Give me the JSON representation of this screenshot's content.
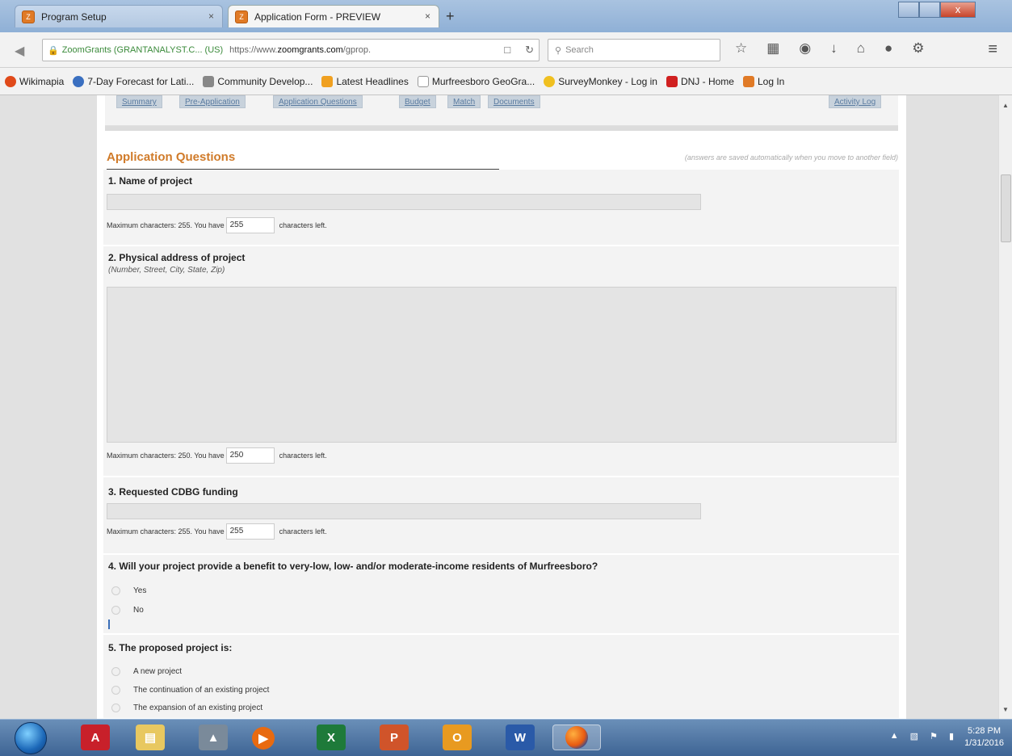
{
  "browser": {
    "tabs": [
      {
        "label": "Program Setup",
        "close": "×"
      },
      {
        "label": "Application Form - PREVIEW",
        "close": "×"
      }
    ],
    "new_tab": "+",
    "window_close": "x",
    "url_identity": "ZoomGrants (GRANTANALYST.C... (US)",
    "url_prefix": "https://www.",
    "url_domain": "zoomgrants.com",
    "url_suffix": "/gprop.",
    "search_placeholder": "Search"
  },
  "bookmarks": [
    {
      "label": "Wikimapia",
      "color": "#e04a1a"
    },
    {
      "label": "7-Day Forecast for Lati...",
      "color": "#3a6fc0"
    },
    {
      "label": "Community Develop...",
      "color": "#888888"
    },
    {
      "label": "Latest Headlines",
      "color": "#f0a020"
    },
    {
      "label": "Murfreesboro GeoGra...",
      "color": "#ffffff"
    },
    {
      "label": "SurveyMonkey - Log in",
      "color": "#f0c020"
    },
    {
      "label": "DNJ - Home",
      "color": "#d02020"
    },
    {
      "label": "Log In",
      "color": "#e07a26"
    }
  ],
  "page_tabs": [
    "Summary",
    "Pre-Application",
    "Application Questions",
    "Budget",
    "Match",
    "Documents",
    "Activity Log"
  ],
  "section": {
    "title": "Application Questions",
    "autosave_note": "(answers are saved automatically when you move to another field)"
  },
  "questions": {
    "q1": {
      "title": "1. Name of project",
      "limit_text": "Maximum characters: 255. You have",
      "remaining": "255",
      "suffix": "characters left."
    },
    "q2": {
      "title": "2. Physical address of project",
      "hint": "(Number, Street, City, State, Zip)",
      "limit_text": "Maximum characters: 250. You have",
      "remaining": "250",
      "suffix": "characters left."
    },
    "q3": {
      "title": "3. Requested CDBG funding",
      "limit_text": "Maximum characters: 255. You have",
      "remaining": "255",
      "suffix": "characters left."
    },
    "q4": {
      "title": "4. Will your project provide a benefit to very-low, low- and/or moderate-income residents of Murfreesboro?",
      "options": [
        "Yes",
        "No"
      ]
    },
    "q5": {
      "title": "5. The proposed project is:",
      "options": [
        "A new project",
        "The continuation of an existing project",
        "The expansion of an existing project"
      ]
    }
  },
  "taskbar": {
    "apps": [
      "start-button",
      "acrobat-icon",
      "explorer-icon",
      "network-icon",
      "media-player-icon",
      "excel-icon",
      "powerpoint-icon",
      "outlook-icon",
      "word-icon",
      "firefox-icon"
    ],
    "clock_time": "5:28 PM",
    "clock_date": "1/31/2016"
  }
}
